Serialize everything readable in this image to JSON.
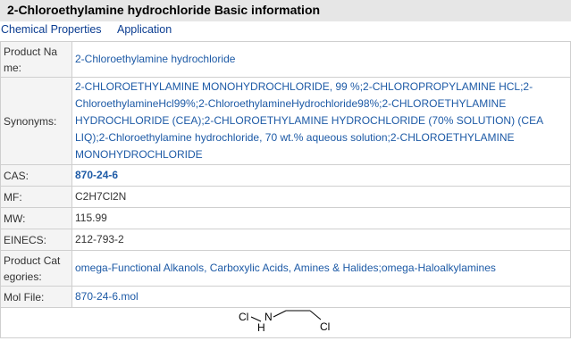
{
  "header": {
    "title": "2-Chloroethylamine hydrochloride Basic information"
  },
  "tabs": [
    {
      "label": "Chemical Properties"
    },
    {
      "label": "Application"
    }
  ],
  "rows": {
    "product_name": {
      "label": "Product Na me:",
      "value": "2-Chloroethylamine hydrochloride"
    },
    "synonyms": {
      "label": "Synonyms:",
      "value": "2-CHLOROETHYLAMINE MONOHYDROCHLORIDE, 99 %;2-CHLOROPROPYLAMINE HCL;2-ChloroethylamineHcl99%;2-ChloroethylamineHydrochloride98%;2-CHLOROETHYLAMINE HYDROCHLORIDE (CEA);2-CHLOROETHYLAMINE HYDROCHLORIDE (70% SOLUTION) (CEA LIQ);2-Chloroethylamine hydrochloride, 70 wt.% aqueous solution;2-CHLOROETHYLAMINE MONOHYDROCHLORIDE"
    },
    "cas": {
      "label": "CAS:",
      "value": "870-24-6"
    },
    "mf": {
      "label": "MF:",
      "value": "C2H7Cl2N"
    },
    "mw": {
      "label": "MW:",
      "value": "115.99"
    },
    "einecs": {
      "label": "EINECS:",
      "value": "212-793-2"
    },
    "product_categories": {
      "label": "Product Cat egories:",
      "value": "omega-Functional Alkanols, Carboxylic Acids, Amines & Halides;omega-Haloalkylamines"
    },
    "mol_file": {
      "label": "Mol File:",
      "value": "870-24-6.mol"
    }
  },
  "structure": {
    "atom_cl_left": "Cl",
    "atom_h": "H",
    "atom_n": "N",
    "atom_cl_right": "Cl"
  }
}
